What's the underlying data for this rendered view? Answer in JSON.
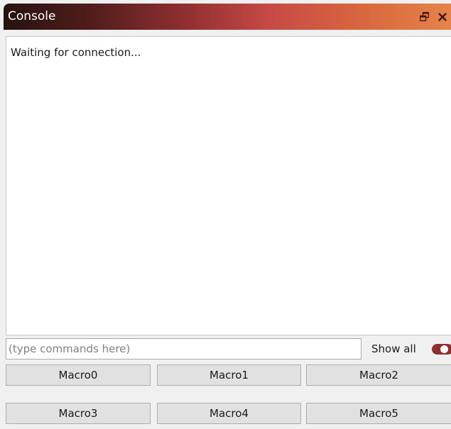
{
  "window": {
    "title": "Console",
    "float_icon": "float-restore-icon",
    "close_icon": "close-icon"
  },
  "console": {
    "output_text": "Waiting for connection..."
  },
  "command": {
    "placeholder": "(type commands here)",
    "value": ""
  },
  "show_all": {
    "label": "Show all",
    "enabled": true
  },
  "macros": [
    {
      "label": "Macro0"
    },
    {
      "label": "Macro1"
    },
    {
      "label": "Macro2"
    },
    {
      "label": "Macro3"
    },
    {
      "label": "Macro4"
    },
    {
      "label": "Macro5"
    }
  ],
  "colors": {
    "title_gradient_start": "#27120f",
    "title_gradient_end": "#e5844a",
    "toggle_on": "#8e2e2e"
  }
}
